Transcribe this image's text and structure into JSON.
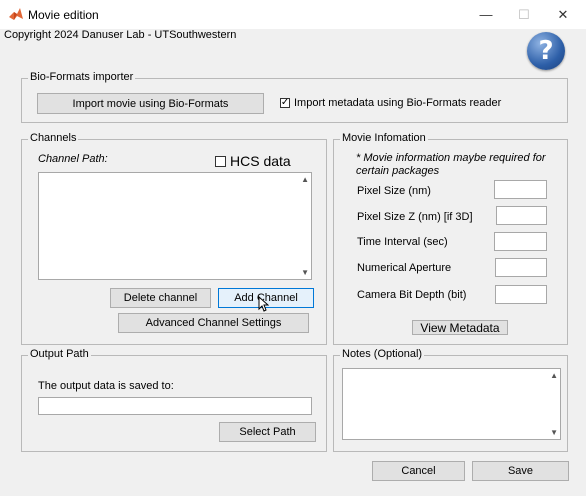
{
  "window": {
    "title": "Movie edition",
    "minimize": "—",
    "maximize": "☐",
    "close": "✕"
  },
  "copyright": "Copyright 2024 Danuser Lab - UTSouthwestern",
  "help": {
    "label": "?"
  },
  "bioformats": {
    "title": "Bio-Formats importer",
    "import_button": "Import movie using Bio-Formats",
    "metadata_checkbox_label": "Import metadata using Bio-Formats reader",
    "metadata_checked": true
  },
  "channels": {
    "title": "Channels",
    "path_label": "Channel Path:",
    "hcs_label": "HCS data",
    "hcs_checked": false,
    "delete_button": "Delete channel",
    "add_button": "Add Channel",
    "advanced_button": "Advanced Channel Settings"
  },
  "movie_info": {
    "title": "Movie Infomation",
    "note": "* Movie information maybe required for certain packages",
    "fields": [
      {
        "label": "Pixel Size (nm)",
        "value": ""
      },
      {
        "label": "Pixel Size Z (nm) [if 3D]",
        "value": ""
      },
      {
        "label": "Time Interval (sec)",
        "value": ""
      },
      {
        "label": "Numerical Aperture",
        "value": ""
      },
      {
        "label": "Camera Bit Depth (bit)",
        "value": ""
      }
    ],
    "view_metadata_button": "View Metadata"
  },
  "output": {
    "title": "Output Path",
    "saved_label": "The output data is saved to:",
    "path_value": "",
    "select_button": "Select Path"
  },
  "notes": {
    "title": "Notes (Optional)",
    "value": ""
  },
  "footer": {
    "cancel_button": "Cancel",
    "save_button": "Save"
  }
}
